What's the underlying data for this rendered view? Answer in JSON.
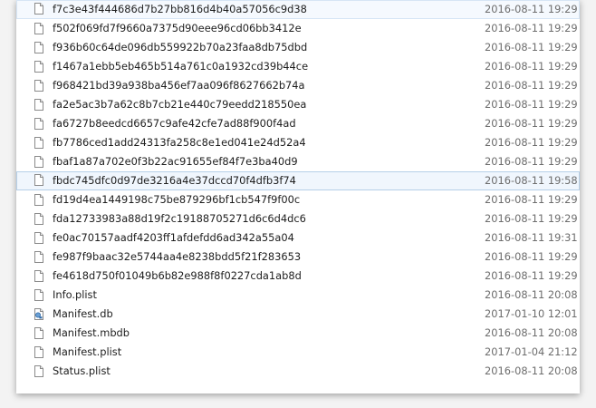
{
  "files": [
    {
      "name": "f7c3e43f444686d7b27bb816d4b40a57056c9d38",
      "date": "2016-08-11 19:29",
      "icon": "file-icon",
      "state": "hover"
    },
    {
      "name": "f502f069fd7f9660a7375d90eee96cd06bb3412e",
      "date": "2016-08-11 19:29",
      "icon": "file-icon",
      "state": ""
    },
    {
      "name": "f936b60c64de096db559922b70a23faa8db75dbd",
      "date": "2016-08-11 19:29",
      "icon": "file-icon",
      "state": ""
    },
    {
      "name": "f1467a1ebb5eb465b514a761c0a1932cd39b44ce",
      "date": "2016-08-11 19:29",
      "icon": "file-icon",
      "state": ""
    },
    {
      "name": "f968421bd39a938ba456ef7aa096f8627662b74a",
      "date": "2016-08-11 19:29",
      "icon": "file-icon",
      "state": ""
    },
    {
      "name": "fa2e5ac3b7a62c8b7cb21e440c79eedd218550ea",
      "date": "2016-08-11 19:29",
      "icon": "file-icon",
      "state": ""
    },
    {
      "name": "fa6727b8eedcd6657c9afe42cfe7ad88f900f4ad",
      "date": "2016-08-11 19:29",
      "icon": "file-icon",
      "state": ""
    },
    {
      "name": "fb7786ced1add24313fa258c8e1ed041e24d52a4",
      "date": "2016-08-11 19:29",
      "icon": "file-icon",
      "state": ""
    },
    {
      "name": "fbaf1a87a702e0f3b22ac91655ef84f7e3ba40d9",
      "date": "2016-08-11 19:29",
      "icon": "file-icon",
      "state": ""
    },
    {
      "name": "fbdc745dfc0d97de3216a4e37dccd70f4dfb3f74",
      "date": "2016-08-11 19:58",
      "icon": "file-icon",
      "state": "selected"
    },
    {
      "name": "fd19d4ea1449198c75be879296bf1cb547f9f00c",
      "date": "2016-08-11 19:29",
      "icon": "file-icon",
      "state": ""
    },
    {
      "name": "fda12733983a88d19f2c19188705271d6c6d4dc6",
      "date": "2016-08-11 19:29",
      "icon": "file-icon",
      "state": ""
    },
    {
      "name": "fe0ac70157aadf4203ff1afdefdd6ad342a55a04",
      "date": "2016-08-11 19:31",
      "icon": "file-icon",
      "state": ""
    },
    {
      "name": "fe987f9baac32e5744aa4e8238bdd5f21f283653",
      "date": "2016-08-11 19:29",
      "icon": "file-icon",
      "state": ""
    },
    {
      "name": "fe4618d750f01049b6b82e988f8f0227cda1ab8d",
      "date": "2016-08-11 19:29",
      "icon": "file-icon",
      "state": ""
    },
    {
      "name": "Info.plist",
      "date": "2016-08-11 20:08",
      "icon": "file-icon",
      "state": ""
    },
    {
      "name": "Manifest.db",
      "date": "2017-01-10 12:01",
      "icon": "database-file-icon",
      "state": ""
    },
    {
      "name": "Manifest.mbdb",
      "date": "2016-08-11 20:08",
      "icon": "file-icon",
      "state": ""
    },
    {
      "name": "Manifest.plist",
      "date": "2017-01-04 21:12",
      "icon": "file-icon",
      "state": ""
    },
    {
      "name": "Status.plist",
      "date": "2016-08-11 20:08",
      "icon": "file-icon",
      "state": ""
    }
  ],
  "colors": {
    "selected_bg": "#f0f6fd",
    "selected_border": "#b5cfe8",
    "date_text": "#6d6d6d",
    "name_text": "#1e1e1e"
  }
}
